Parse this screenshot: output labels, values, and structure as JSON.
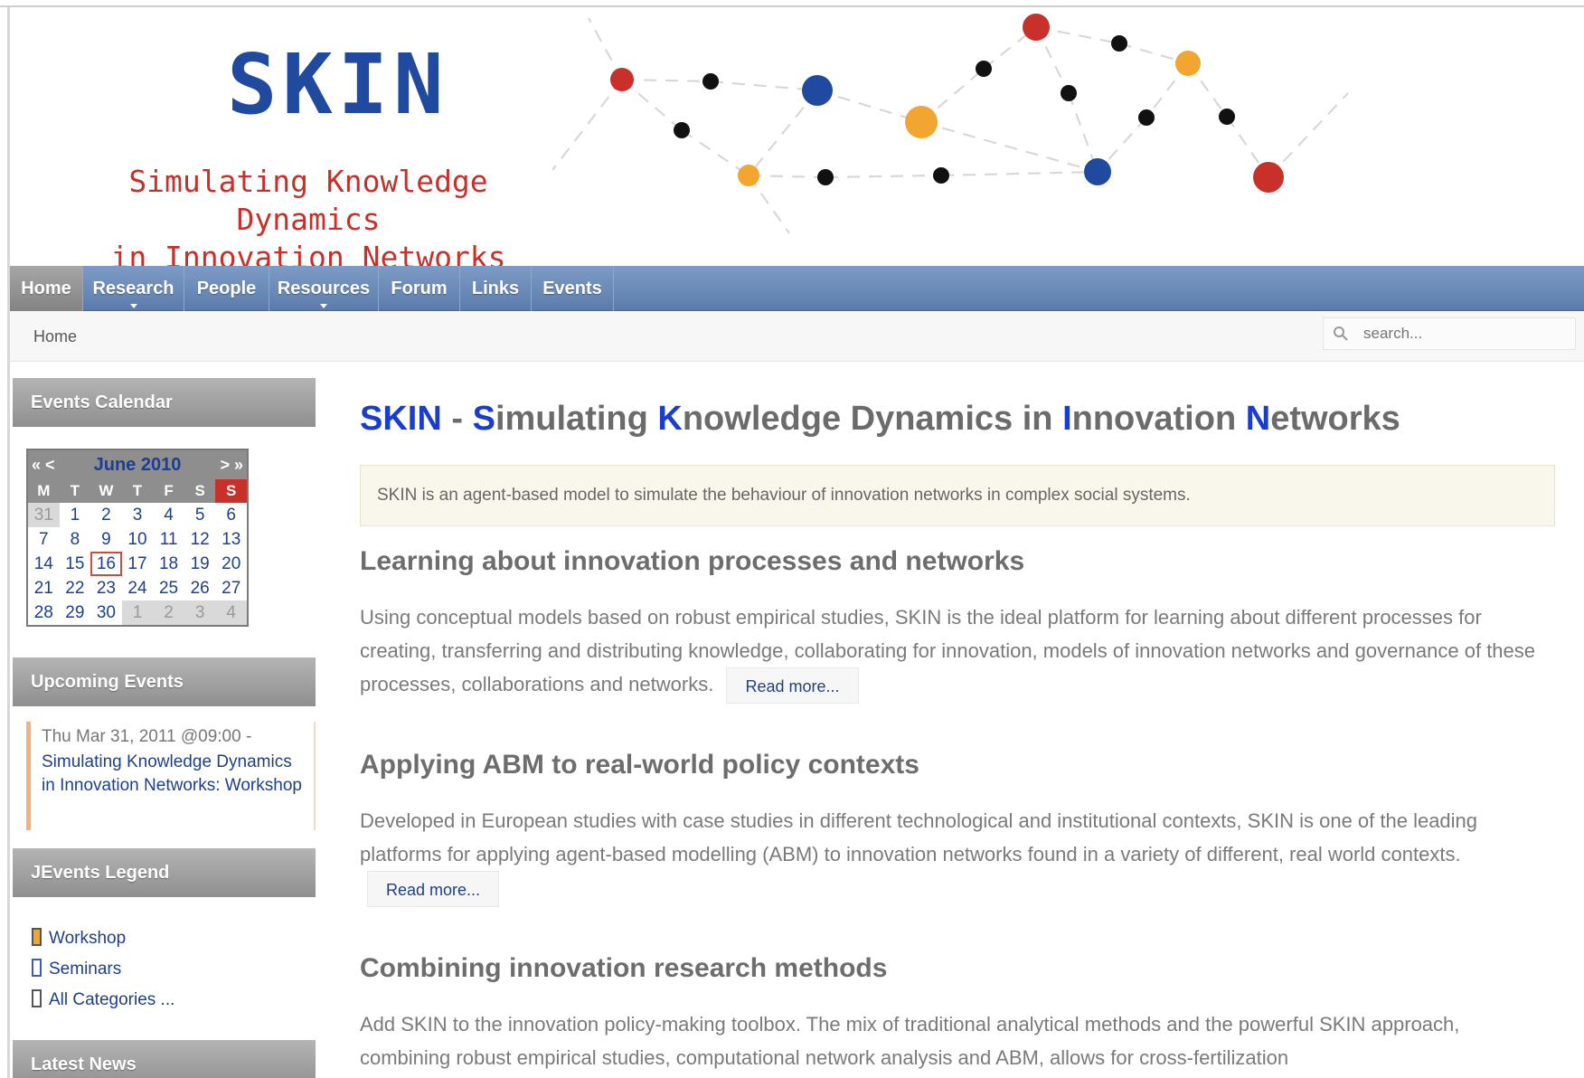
{
  "header": {
    "logo_text": "SKIN",
    "tagline_line1": "Simulating Knowledge Dynamics",
    "tagline_line2": "in Innovation Networks"
  },
  "colors": {
    "logo_blue": "#1f4aa0",
    "tagline_red": "#c8302a",
    "nav_blue": "#6a89b8",
    "title_highlight": "#1a3dd0",
    "node_red": "#c8302a",
    "node_blue": "#1f4aa0",
    "node_orange": "#f2a531",
    "node_black": "#111111"
  },
  "nav": {
    "items": [
      {
        "label": "Home",
        "active": true
      },
      {
        "label": "Research",
        "has_dropdown": true
      },
      {
        "label": "People"
      },
      {
        "label": "Resources",
        "has_dropdown": true
      },
      {
        "label": "Forum"
      },
      {
        "label": "Links"
      },
      {
        "label": "Events"
      }
    ]
  },
  "breadcrumb": {
    "current": "Home"
  },
  "search": {
    "placeholder": "search...",
    "icon": "search-icon"
  },
  "sidebar": {
    "calendar": {
      "heading": "Events Calendar",
      "month_label": "June 2010",
      "prev_label": "« <",
      "next_label": "> »",
      "weekdays": [
        "M",
        "T",
        "W",
        "T",
        "F",
        "S",
        "S"
      ],
      "rows": [
        [
          "31",
          "1",
          "2",
          "3",
          "4",
          "5",
          "6"
        ],
        [
          "7",
          "8",
          "9",
          "10",
          "11",
          "12",
          "13"
        ],
        [
          "14",
          "15",
          "16",
          "17",
          "18",
          "19",
          "20"
        ],
        [
          "21",
          "22",
          "23",
          "24",
          "25",
          "26",
          "27"
        ],
        [
          "28",
          "29",
          "30",
          "1",
          "2",
          "3",
          "4"
        ]
      ],
      "today": "16"
    },
    "upcoming": {
      "heading": "Upcoming Events",
      "date": "Thu Mar 31, 2011 @09:00 -",
      "title": "Simulating Knowledge Dynamics in Innovation Networks: Workshop"
    },
    "legend": {
      "heading": "JEvents Legend",
      "items": [
        {
          "label": "Workshop",
          "color": "#f2a531"
        },
        {
          "label": "Seminars",
          "color": "#3a5fb0"
        },
        {
          "label": "All Categories ...",
          "color": "#888888"
        }
      ]
    },
    "news": {
      "heading": "Latest News"
    }
  },
  "main": {
    "title_parts": [
      {
        "text": "SKIN",
        "hl": true
      },
      {
        "text": " - ",
        "hl": false
      },
      {
        "text": "S",
        "hl": true
      },
      {
        "text": "imulating ",
        "hl": false
      },
      {
        "text": "K",
        "hl": true
      },
      {
        "text": "nowledge Dynamics in ",
        "hl": false
      },
      {
        "text": "I",
        "hl": true
      },
      {
        "text": "nnovation ",
        "hl": false
      },
      {
        "text": "N",
        "hl": true
      },
      {
        "text": "etworks",
        "hl": false
      }
    ],
    "intro": "SKIN is an agent-based model to simulate the behaviour of innovation networks in complex social systems.",
    "sections": [
      {
        "heading": "Learning about innovation processes and networks",
        "text": "Using conceptual models based on robust empirical studies, SKIN is the ideal platform for learning about different processes for creating, transferring and distributing knowledge, collaborating for innovation, models of innovation networks and governance of these processes, collaborations and networks.",
        "read_more": "Read more..."
      },
      {
        "heading": "Applying ABM to real-world policy contexts",
        "text": "Developed in European studies with case studies in different technological and institutional contexts, SKIN is one of the leading platforms for applying agent-based modelling (ABM) to innovation networks found in a variety of different, real world contexts.",
        "read_more": "Read more..."
      },
      {
        "heading": "Combining innovation research methods",
        "text": "Add SKIN to the innovation policy-making toolbox. The mix of traditional analytical methods and the powerful SKIN approach, combining robust empirical studies, computational network analysis and ABM, allows for cross-fertilization"
      }
    ]
  }
}
